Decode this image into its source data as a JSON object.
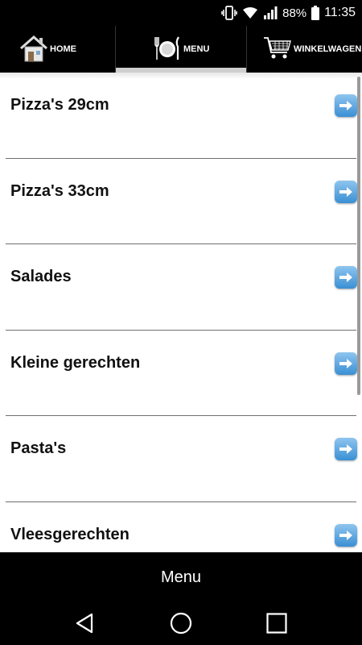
{
  "status_bar": {
    "battery_percent": "88%",
    "time": "11:35",
    "icons": [
      "vibrate-icon",
      "wifi-icon",
      "signal-icon",
      "battery-icon"
    ]
  },
  "topnav": {
    "tabs": [
      {
        "label": "HOME",
        "icon": "home-icon"
      },
      {
        "label": "MENU",
        "icon": "plate-cutlery-icon",
        "active": true
      },
      {
        "label": "WINKELWAGEN",
        "icon": "shopping-cart-icon"
      }
    ]
  },
  "menu_list": {
    "items": [
      {
        "label": "Pizza's 29cm"
      },
      {
        "label": "Pizza's 33cm"
      },
      {
        "label": "Salades"
      },
      {
        "label": "Kleine gerechten"
      },
      {
        "label": "Pasta's"
      },
      {
        "label": "Vleesgerechten"
      }
    ],
    "arrow_icon": "arrow-right-icon"
  },
  "bottom_bar": {
    "title": "Menu"
  },
  "android_nav": {
    "buttons": [
      "back-icon",
      "home-circle-icon",
      "recents-icon"
    ]
  }
}
